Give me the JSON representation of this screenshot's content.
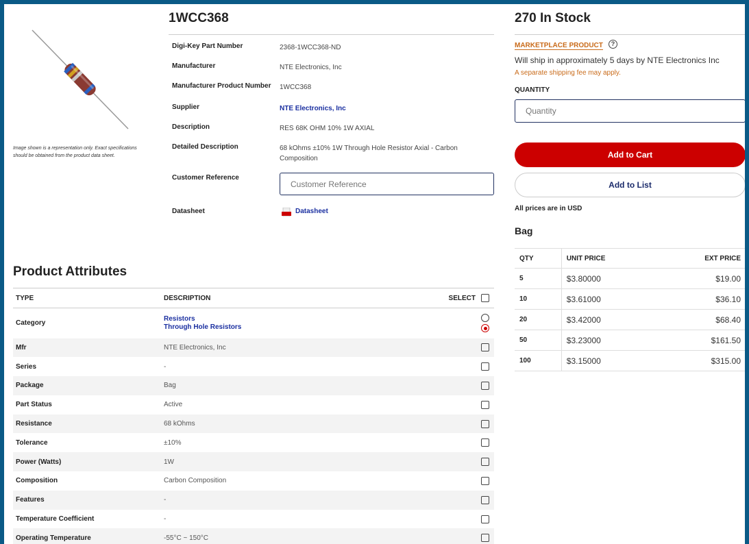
{
  "product": {
    "title": "1WCC368",
    "image_note": "Image shown is a representation only. Exact specifications should be obtained from the product data sheet."
  },
  "details": [
    {
      "label": "Digi-Key Part Number",
      "value": "2368-1WCC368-ND"
    },
    {
      "label": "Manufacturer",
      "value": "NTE Electronics, Inc"
    },
    {
      "label": "Manufacturer Product Number",
      "value": "1WCC368"
    },
    {
      "label": "Supplier",
      "value": "NTE Electronics, Inc"
    },
    {
      "label": "Description",
      "value": "RES 68K OHM 10% 1W AXIAL"
    },
    {
      "label": "Detailed Description",
      "value": "68 kOhms ±10% 1W Through Hole Resistor Axial - Carbon Composition"
    },
    {
      "label": "Customer Reference",
      "placeholder": "Customer Reference"
    },
    {
      "label": "Datasheet",
      "link": "Datasheet"
    }
  ],
  "stock": {
    "title": "270 In Stock",
    "marketplace": "MARKETPLACE PRODUCT",
    "ship_note": "Will ship in approximately 5 days by NTE Electronics Inc",
    "fee_note": "A separate shipping fee may apply.",
    "quantity_label": "QUANTITY",
    "quantity_placeholder": "Quantity",
    "add_to_cart": "Add to Cart",
    "add_to_list": "Add to List",
    "currency_note": "All prices are in USD",
    "packaging": "Bag"
  },
  "pricing": {
    "headers": [
      "QTY",
      "UNIT PRICE",
      "EXT PRICE"
    ],
    "rows": [
      [
        "5",
        "$3.80000",
        "$19.00"
      ],
      [
        "10",
        "$3.61000",
        "$36.10"
      ],
      [
        "20",
        "$3.42000",
        "$68.40"
      ],
      [
        "50",
        "$3.23000",
        "$161.50"
      ],
      [
        "100",
        "$3.15000",
        "$315.00"
      ]
    ]
  },
  "attributes": {
    "title": "Product Attributes",
    "headers": {
      "type": "TYPE",
      "description": "DESCRIPTION",
      "select": "SELECT"
    },
    "category": {
      "type": "Category",
      "links": [
        "Resistors",
        "Through Hole Resistors"
      ]
    },
    "rows": [
      {
        "type": "Mfr",
        "value": "NTE Electronics, Inc"
      },
      {
        "type": "Series",
        "value": "-"
      },
      {
        "type": "Package",
        "value": "Bag"
      },
      {
        "type": "Part Status",
        "value": "Active"
      },
      {
        "type": "Resistance",
        "value": "68 kOhms"
      },
      {
        "type": "Tolerance",
        "value": "±10%"
      },
      {
        "type": "Power (Watts)",
        "value": "1W"
      },
      {
        "type": "Composition",
        "value": "Carbon Composition"
      },
      {
        "type": "Features",
        "value": "-"
      },
      {
        "type": "Temperature Coefficient",
        "value": "-"
      },
      {
        "type": "Operating Temperature",
        "value": "-55°C ~ 150°C"
      }
    ]
  },
  "colors": {
    "accent_red": "#cc0000",
    "link_blue": "#1a2fa0",
    "marketplace_orange": "#c96b1a",
    "frame_blue": "#0a5a86"
  }
}
